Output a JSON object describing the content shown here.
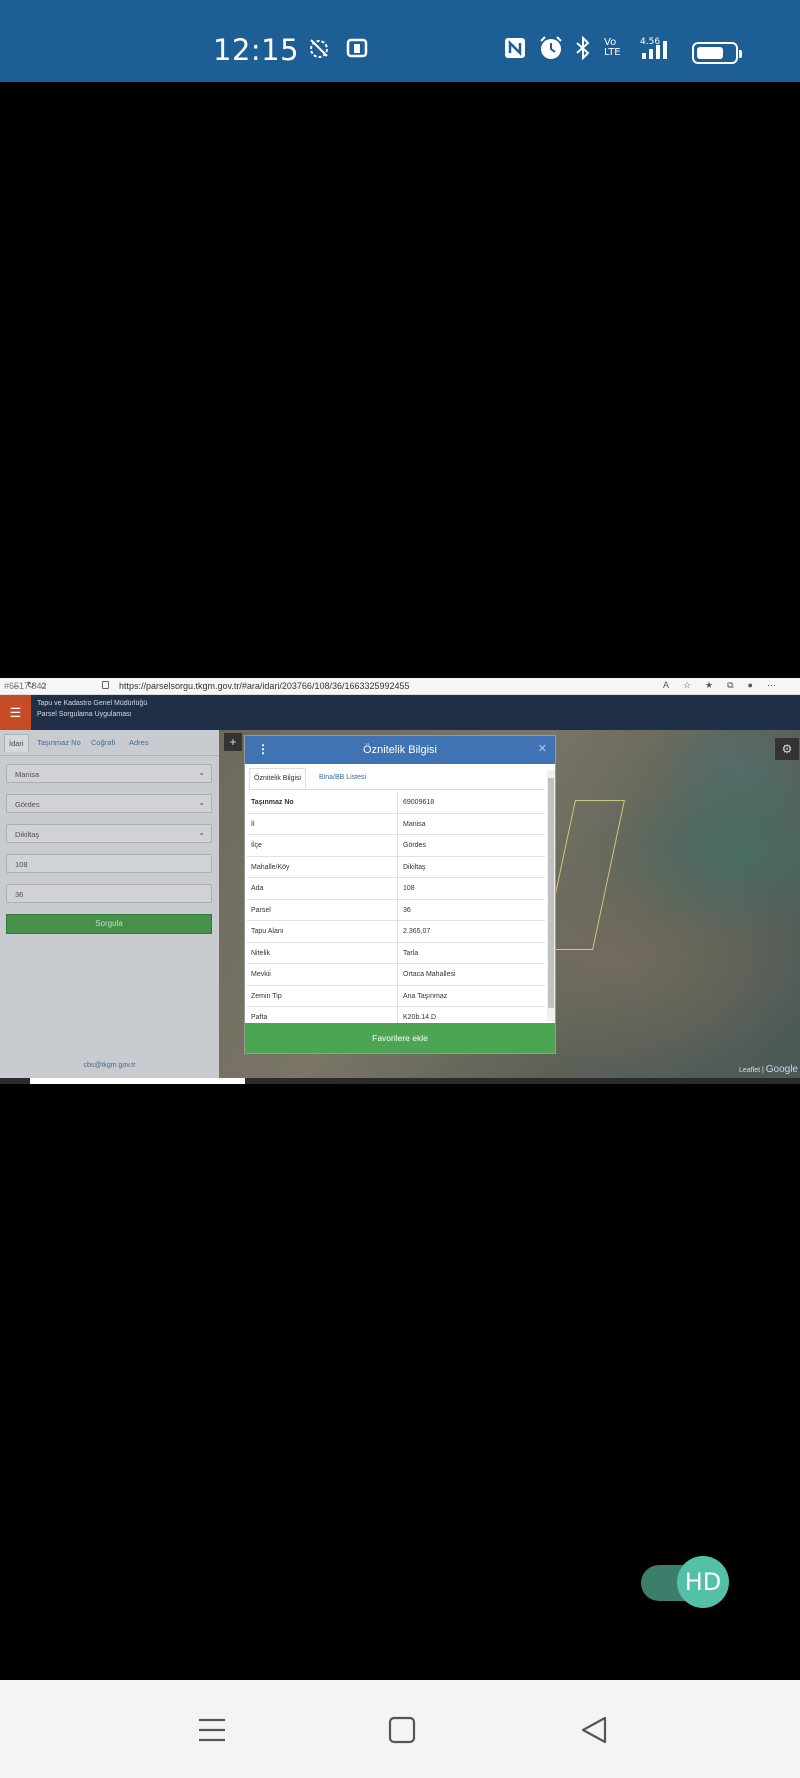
{
  "status_bar": {
    "time": "12:15",
    "network": "4.56",
    "volte": "Vo LTE",
    "icons": [
      "no-alarm-icon",
      "b-icon",
      "nfc-icon",
      "alarm-icon",
      "bluetooth-icon",
      "volte-icon",
      "signal-icon",
      "battery-icon"
    ]
  },
  "browser": {
    "tab_id": "#6517",
    "tab_id2": "842",
    "url": "https://parselsorgu.tkgm.gov.tr/#ara/idari/203766/108/36/1663325992455",
    "toolbar_icons": [
      "read-aloud-icon",
      "favorite-add-icon",
      "favorites-icon",
      "collections-icon",
      "profile-icon",
      "more-icon"
    ]
  },
  "app": {
    "org_line1": "Tapu ve Kadastro Genel Müdürlüğü",
    "org_line2": "Parsel Sorgulama Uygulaması",
    "tabs": [
      "İdari",
      "Taşınmaz No",
      "Coğrafi",
      "Adres"
    ],
    "fields": {
      "il": "Manisa",
      "ilce": "Gördes",
      "mahalle": "Dikiltaş",
      "ada": "108",
      "parsel": "36"
    },
    "search_button": "Sorgula",
    "email": "cbs@tkgm.gov.tr",
    "map_attribution": "Leaflet |",
    "map_attribution_brand": "Google"
  },
  "modal": {
    "title": "Öznitelik Bilgisi",
    "tabs": [
      "Öznitelik Bilgisi",
      "Bina/BB Listesi"
    ],
    "rows": [
      {
        "key": "Taşınmaz No",
        "value": "69009618"
      },
      {
        "key": "İl",
        "value": "Manisa"
      },
      {
        "key": "İlçe",
        "value": "Gördes"
      },
      {
        "key": "Mahalle/Köy",
        "value": "Dikiltaş"
      },
      {
        "key": "Ada",
        "value": "108"
      },
      {
        "key": "Parsel",
        "value": "36"
      },
      {
        "key": "Tapu Alanı",
        "value": "2.365,07"
      },
      {
        "key": "Nitelik",
        "value": "Tarla"
      },
      {
        "key": "Mevkii",
        "value": "Ortaca Mahallesi"
      },
      {
        "key": "Zemin Tip",
        "value": "Ana Taşınmaz"
      },
      {
        "key": "Pafta",
        "value": "K20b.14.D"
      }
    ],
    "favorite_button": "Favorilere ekle"
  },
  "hd_toggle": {
    "label": "HD",
    "on": true
  },
  "colors": {
    "status_bar": "#1d5e94",
    "app_header": "#1e2f47",
    "menu_button": "#c54c25",
    "modal_header": "#3f73b4",
    "green_button": "#4ca552",
    "hd_knob": "#53c1a6"
  }
}
